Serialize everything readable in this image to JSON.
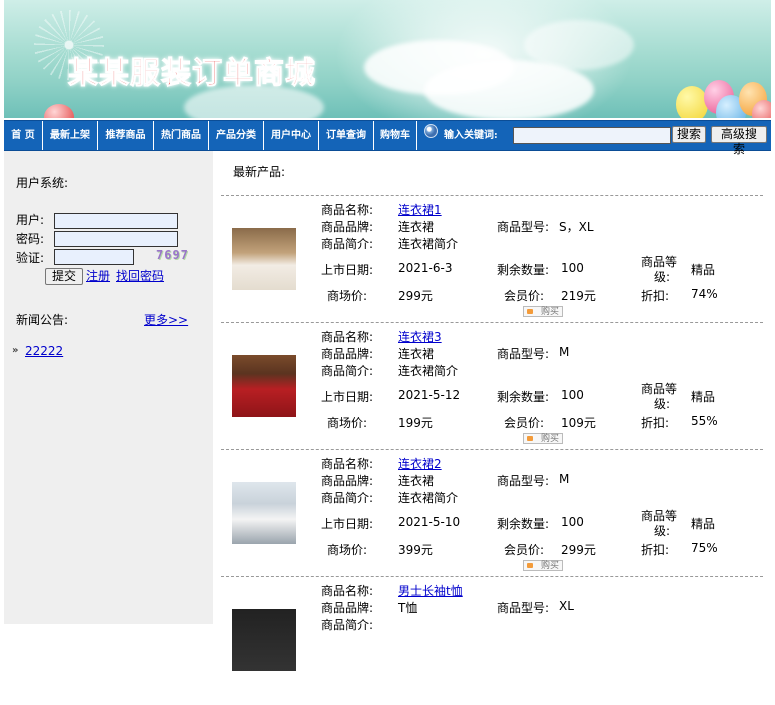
{
  "banner": {
    "title": "某某服装订单商城"
  },
  "nav": {
    "items": [
      "首 页",
      "最新上架",
      "推荐商品",
      "热门商品",
      "产品分类",
      "用户中心",
      "订单查询",
      "购物车"
    ],
    "search_label": "输入关键词:",
    "search_value": "",
    "search_button": "搜索",
    "advanced_button": "高级搜索"
  },
  "sidebar": {
    "user_system": "用户系统:",
    "user_label": "用户:",
    "password_label": "密码:",
    "verify_label": "验证:",
    "captcha": "7697",
    "submit": "提交",
    "register": "注册",
    "recover": "找回密码",
    "news_title": "新闻公告:",
    "more": "更多>>",
    "news_items": [
      "22222"
    ]
  },
  "main": {
    "title": "最新产品:",
    "labels": {
      "name": "商品名称:",
      "brand": "商品品牌:",
      "intro": "商品简介:",
      "model": "商品型号:",
      "date": "上市日期:",
      "stock": "剩余数量:",
      "grade_1": "商品等",
      "grade_2": "级:",
      "market_price": "商场价:",
      "member_price": "会员价:",
      "discount": "折扣:",
      "buy": "购买"
    },
    "products": [
      {
        "name": "连衣裙1",
        "brand": "连衣裙",
        "intro": "连衣裙简介",
        "model": "S，XL",
        "date": "2021-6-3",
        "stock": "100",
        "grade": "精品",
        "market_price": "299元",
        "member_price": "219元",
        "discount": "74%"
      },
      {
        "name": "连衣裙3",
        "brand": "连衣裙",
        "intro": "连衣裙简介",
        "model": "M",
        "date": "2021-5-12",
        "stock": "100",
        "grade": "精品",
        "market_price": "199元",
        "member_price": "109元",
        "discount": "55%"
      },
      {
        "name": "连衣裙2",
        "brand": "连衣裙",
        "intro": "连衣裙简介",
        "model": "M",
        "date": "2021-5-10",
        "stock": "100",
        "grade": "精品",
        "market_price": "399元",
        "member_price": "299元",
        "discount": "75%"
      },
      {
        "name": "男士长袖t恤",
        "brand": "T恤",
        "intro": "",
        "model": "XL",
        "date": "",
        "stock": "",
        "grade": "",
        "market_price": "",
        "member_price": "",
        "discount": ""
      }
    ]
  },
  "colors": {
    "nav_bg": "#1464b8",
    "title_red": "#e85353",
    "link_blue": "#0000cc",
    "sidebar_bg": "#efefef"
  }
}
